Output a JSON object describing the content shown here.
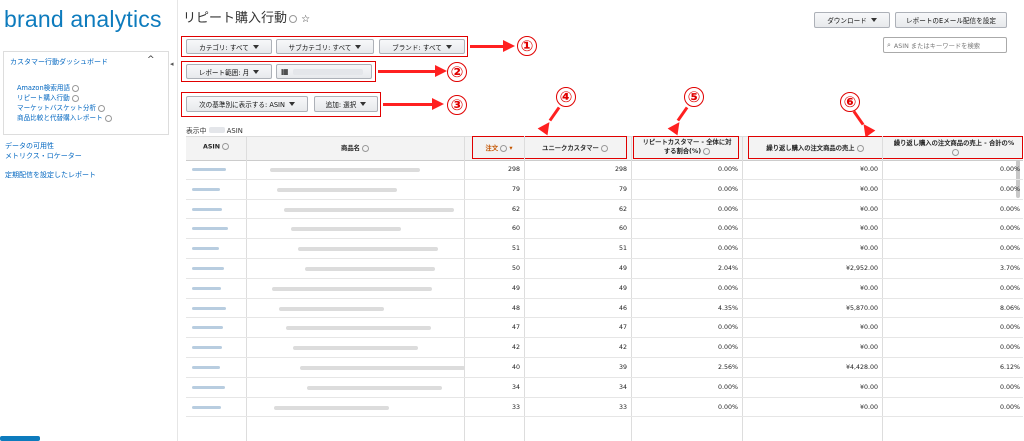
{
  "sidebar": {
    "logo": "brand analytics",
    "dashboard_label": "カスタマー行動ダッシュボード",
    "sub_items": [
      "Amazon検索用語",
      "リピート購入行動",
      "マーケットバスケット分析",
      "商品比較と代替購入レポート"
    ],
    "links": [
      "データの可用性",
      "メトリクス・ロケーター",
      "定期配信を設定したレポート"
    ]
  },
  "header": {
    "title": "リピート購入行動",
    "download_label": "ダウンロード",
    "email_label": "レポートのEメール配信を設定",
    "search_placeholder": "ASIN またはキーワードを検索"
  },
  "filters": {
    "category": "カテゴリ: すべて",
    "subcategory": "サブカテゴリ: すべて",
    "brand": "ブランド: すべて",
    "range": "レポート範囲: 月",
    "view_by": "次の基準別に表示する: ASIN",
    "add": "追加: 選択"
  },
  "markers": [
    "①",
    "②",
    "③",
    "④",
    "⑤",
    "⑥"
  ],
  "showing": {
    "prefix": "表示中",
    "suffix": "ASIN"
  },
  "table": {
    "headers": {
      "asin": "ASIN",
      "name": "商品名",
      "orders": "注文",
      "unique": "ユニークカスタマー",
      "repeat_pct_1": "リピートカスタマー - 全体に対",
      "repeat_pct_2": "する割合(%)",
      "repeat_sales": "繰り返し購入の注文商品の売上",
      "repeat_pct_total": "繰り返し購入の注文商品の売上 - 合計の%"
    },
    "rows": [
      {
        "orders": "298",
        "unique": "298",
        "pct": "0.00%",
        "sales": "¥0.00",
        "share": "0.00%"
      },
      {
        "orders": "79",
        "unique": "79",
        "pct": "0.00%",
        "sales": "¥0.00",
        "share": "0.00%"
      },
      {
        "orders": "62",
        "unique": "62",
        "pct": "0.00%",
        "sales": "¥0.00",
        "share": "0.00%"
      },
      {
        "orders": "60",
        "unique": "60",
        "pct": "0.00%",
        "sales": "¥0.00",
        "share": "0.00%"
      },
      {
        "orders": "51",
        "unique": "51",
        "pct": "0.00%",
        "sales": "¥0.00",
        "share": "0.00%"
      },
      {
        "orders": "50",
        "unique": "49",
        "pct": "2.04%",
        "sales": "¥2,952.00",
        "share": "3.70%"
      },
      {
        "orders": "49",
        "unique": "49",
        "pct": "0.00%",
        "sales": "¥0.00",
        "share": "0.00%"
      },
      {
        "orders": "48",
        "unique": "46",
        "pct": "4.35%",
        "sales": "¥5,870.00",
        "share": "8.06%"
      },
      {
        "orders": "47",
        "unique": "47",
        "pct": "0.00%",
        "sales": "¥0.00",
        "share": "0.00%"
      },
      {
        "orders": "42",
        "unique": "42",
        "pct": "0.00%",
        "sales": "¥0.00",
        "share": "0.00%"
      },
      {
        "orders": "40",
        "unique": "39",
        "pct": "2.56%",
        "sales": "¥4,428.00",
        "share": "6.12%"
      },
      {
        "orders": "34",
        "unique": "34",
        "pct": "0.00%",
        "sales": "¥0.00",
        "share": "0.00%"
      },
      {
        "orders": "33",
        "unique": "33",
        "pct": "0.00%",
        "sales": "¥0.00",
        "share": "0.00%"
      }
    ]
  },
  "colors": {
    "brand": "#0d7bbd",
    "annotation": "#e00000",
    "link": "#0066c0"
  }
}
